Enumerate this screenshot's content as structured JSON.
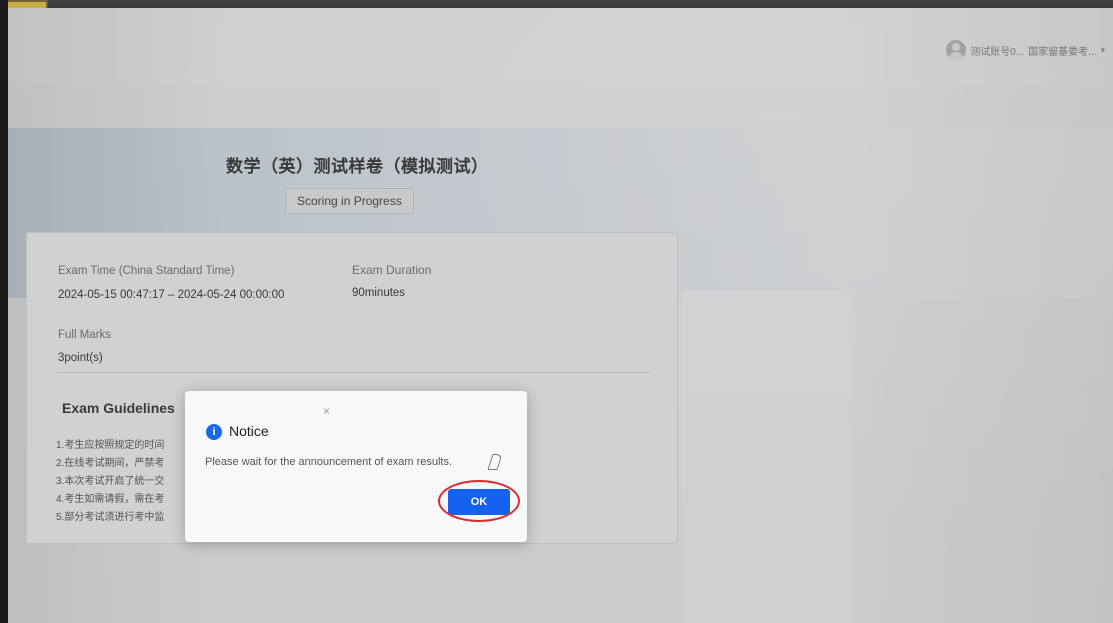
{
  "header": {
    "user_name": "测试账号0...",
    "organization": "国家留基委考...",
    "dropdown_glyph": "▾",
    "avatar_icon": "user-avatar-icon"
  },
  "exam": {
    "title": "数学（英）测试样卷（模拟测试）",
    "status": "Scoring in Progress",
    "time_label": "Exam Time (China Standard Time)",
    "time_value": "2024-05-15 00:47:17 – 2024-05-24 00:00:00",
    "duration_label": "Exam Duration",
    "duration_value": "90minutes",
    "marks_label": "Full Marks",
    "marks_value": "3point(s)"
  },
  "guidelines": {
    "title": "Exam Guidelines",
    "items": [
      "1.考生应按照规定的时间",
      "2.在线考试期间，严禁考",
      "3.本次考试开启了统一交",
      "4.考生如需请假，需在考",
      "5.部分考试须进行考中监"
    ]
  },
  "modal": {
    "title": "Notice",
    "message": "Please wait for the announcement of exam results.",
    "ok_label": "OK",
    "close_glyph": "×",
    "info_glyph": "i",
    "info_icon": "info-icon",
    "close_icon": "close-icon"
  },
  "colors": {
    "primary": "#1561f0",
    "info": "#1769e8",
    "annotation": "#e02a2a"
  }
}
